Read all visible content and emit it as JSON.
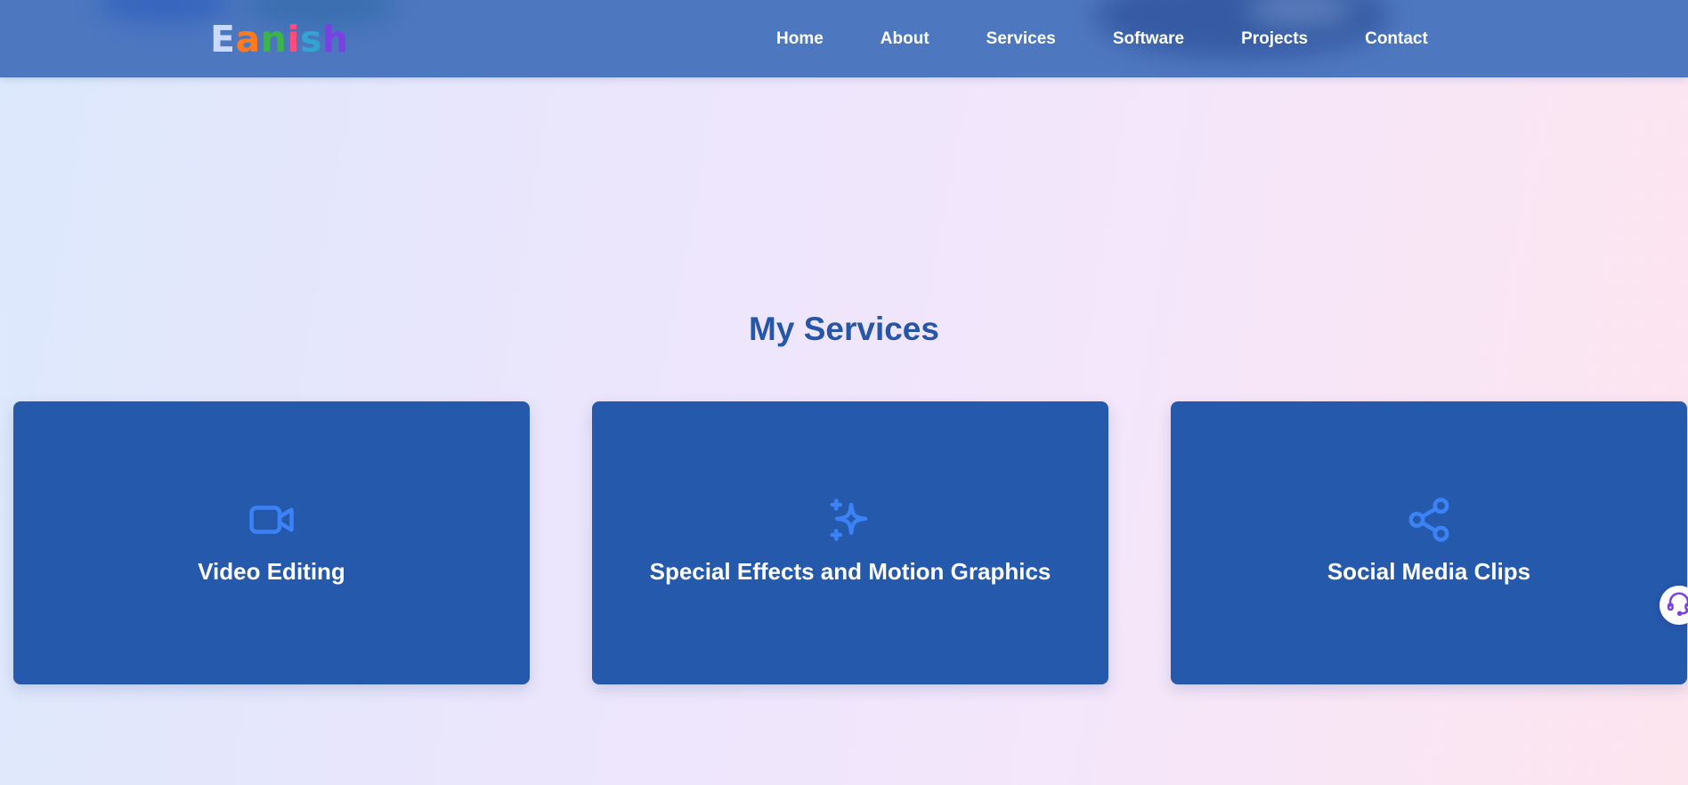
{
  "header": {
    "logo": {
      "letters": [
        {
          "char": "E",
          "color": "#c9d9ff"
        },
        {
          "char": "a",
          "color": "#ff7a1a"
        },
        {
          "char": "n",
          "color": "#3bb54a"
        },
        {
          "char": "i",
          "color": "#ff4b7d"
        },
        {
          "char": "s",
          "color": "#33a3cf"
        },
        {
          "char": "h",
          "color": "#7b3fe4"
        }
      ]
    },
    "nav": [
      {
        "label": "Home"
      },
      {
        "label": "About"
      },
      {
        "label": "Services"
      },
      {
        "label": "Software"
      },
      {
        "label": "Projects"
      },
      {
        "label": "Contact"
      }
    ]
  },
  "services": {
    "title": "My Services",
    "cards": [
      {
        "title": "Video Editing",
        "icon": "video-camera-icon"
      },
      {
        "title": "Special Effects and Motion Graphics",
        "icon": "sparkles-icon"
      },
      {
        "title": "Social Media Clips",
        "icon": "share-icon"
      }
    ]
  },
  "support_widget": {
    "icon": "headset-support-icon"
  },
  "colors": {
    "header_bg": "#4d77bf",
    "card_bg": "#2559ab",
    "title_color": "#2556a8",
    "icon_accent": "#3b82f6",
    "support_accent": "#7b3fe4"
  }
}
